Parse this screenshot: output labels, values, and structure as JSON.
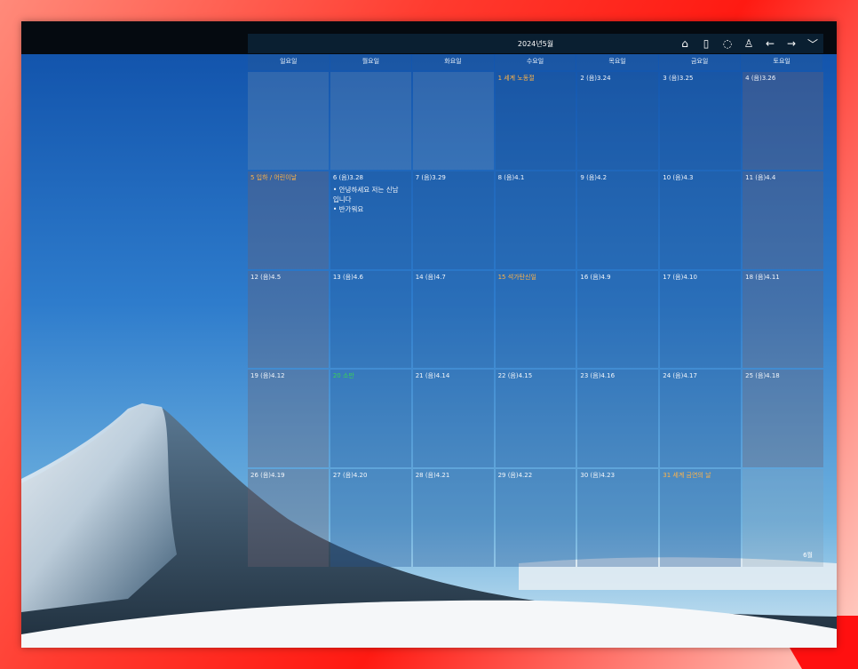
{
  "header": {
    "title": "2024년5월",
    "toolbar": [
      {
        "name": "home-icon",
        "glyph": "⌂"
      },
      {
        "name": "phone-icon",
        "glyph": "▯"
      },
      {
        "name": "cloud-icon",
        "glyph": "◌"
      },
      {
        "name": "user-icon",
        "glyph": "♙"
      },
      {
        "name": "arrow-left-icon",
        "glyph": "←"
      },
      {
        "name": "arrow-right-icon",
        "glyph": "→"
      },
      {
        "name": "chevron-down-icon",
        "glyph": "﹀"
      }
    ]
  },
  "weekdays": [
    "일요일",
    "월요일",
    "화요일",
    "수요일",
    "목요일",
    "금요일",
    "토요일"
  ],
  "weeks": [
    [
      {
        "label": "",
        "type": "empty"
      },
      {
        "label": "",
        "type": "empty"
      },
      {
        "label": "",
        "type": "empty"
      },
      {
        "label": "1 세계 노동절",
        "type": "holiday"
      },
      {
        "label": "2 (음)3.24",
        "type": "normal"
      },
      {
        "label": "3 (음)3.25",
        "type": "normal"
      },
      {
        "label": "4 (음)3.26",
        "type": "normal"
      }
    ],
    [
      {
        "label": "5 입하 / 어린이날",
        "type": "holiday"
      },
      {
        "label": "6 (음)3.28",
        "type": "normal",
        "notes": [
          "• 안녕하세요 저는 신남",
          "입니다",
          "• 반가워요"
        ]
      },
      {
        "label": "7 (음)3.29",
        "type": "normal"
      },
      {
        "label": "8 (음)4.1",
        "type": "normal"
      },
      {
        "label": "9 (음)4.2",
        "type": "normal"
      },
      {
        "label": "10 (음)4.3",
        "type": "normal"
      },
      {
        "label": "11 (음)4.4",
        "type": "normal"
      }
    ],
    [
      {
        "label": "12 (음)4.5",
        "type": "normal"
      },
      {
        "label": "13 (음)4.6",
        "type": "normal"
      },
      {
        "label": "14 (음)4.7",
        "type": "normal"
      },
      {
        "label": "15 석가탄신일",
        "type": "holiday"
      },
      {
        "label": "16 (음)4.9",
        "type": "normal"
      },
      {
        "label": "17 (음)4.10",
        "type": "normal"
      },
      {
        "label": "18 (음)4.11",
        "type": "normal"
      }
    ],
    [
      {
        "label": "19 (음)4.12",
        "type": "normal"
      },
      {
        "label": "20 소만",
        "type": "green"
      },
      {
        "label": "21 (음)4.14",
        "type": "normal"
      },
      {
        "label": "22 (음)4.15",
        "type": "normal"
      },
      {
        "label": "23 (음)4.16",
        "type": "normal"
      },
      {
        "label": "24 (음)4.17",
        "type": "normal"
      },
      {
        "label": "25 (음)4.18",
        "type": "normal"
      }
    ],
    [
      {
        "label": "26 (음)4.19",
        "type": "normal"
      },
      {
        "label": "27 (음)4.20",
        "type": "normal"
      },
      {
        "label": "28 (음)4.21",
        "type": "normal"
      },
      {
        "label": "29 (음)4.22",
        "type": "normal"
      },
      {
        "label": "30 (음)4.23",
        "type": "normal"
      },
      {
        "label": "31 세계 금연의 날",
        "type": "holiday"
      },
      {
        "label": "",
        "type": "empty",
        "next_month": "6월"
      }
    ]
  ],
  "colors": {
    "holiday": "#ffb347",
    "green": "#39d353"
  }
}
